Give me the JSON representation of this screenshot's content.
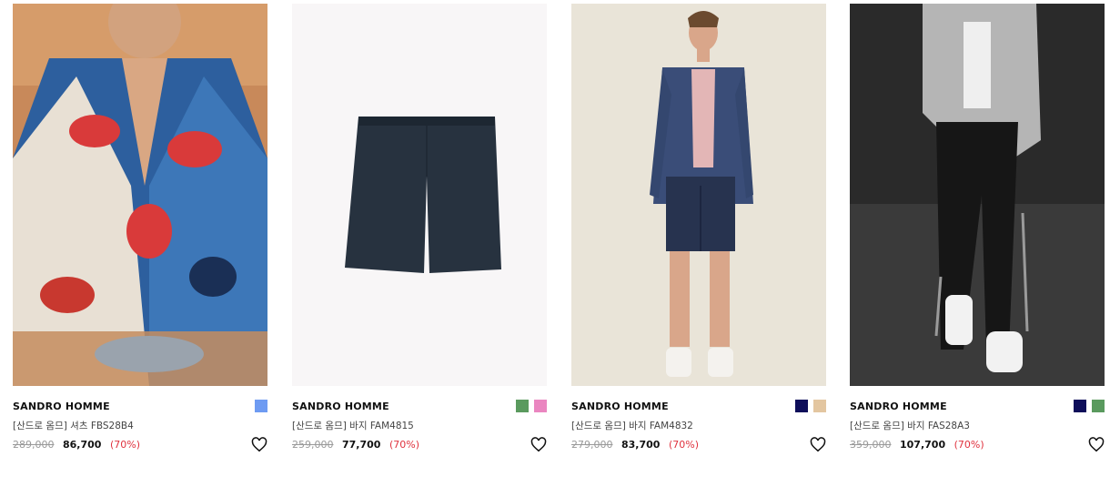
{
  "products": [
    {
      "brand": "SANDRO HOMME",
      "name": "[산드로 옴므] 셔츠 FBS28B4",
      "original_price": "289,000",
      "sale_price": "86,700",
      "discount": "(70%)",
      "swatches": [
        "#6e9bf2"
      ],
      "image": "model-hawaiian-shirt"
    },
    {
      "brand": "SANDRO HOMME",
      "name": "[산드로 옴므] 바지 FAM4815",
      "original_price": "259,000",
      "sale_price": "77,700",
      "discount": "(70%)",
      "swatches": [
        "#5a9a5e",
        "#ea86c0"
      ],
      "image": "navy-shorts-product"
    },
    {
      "brand": "SANDRO HOMME",
      "name": "[산드로 옴므] 바지 FAM4832",
      "original_price": "279,000",
      "sale_price": "83,700",
      "discount": "(70%)",
      "swatches": [
        "#0e0e5a",
        "#e3c6a0"
      ],
      "image": "model-navy-suit-shorts"
    },
    {
      "brand": "SANDRO HOMME",
      "name": "[산드로 옴므] 바지 FAS28A3",
      "original_price": "359,000",
      "sale_price": "107,700",
      "discount": "(70%)",
      "swatches": [
        "#0e0e5a",
        "#5a9a5e"
      ],
      "image": "model-black-trousers-bw"
    }
  ],
  "icons": {
    "wishlist": "heart-outline-icon"
  }
}
